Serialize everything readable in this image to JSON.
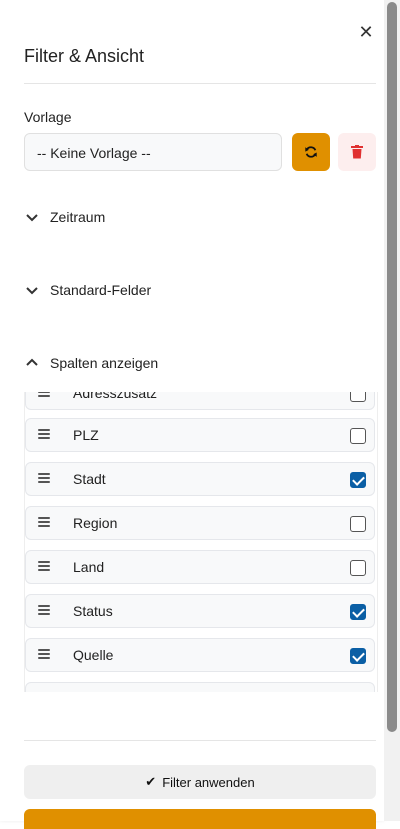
{
  "header": {
    "title": "Filter & Ansicht",
    "close_icon": "close-icon"
  },
  "template": {
    "label": "Vorlage",
    "selected": "-- Keine Vorlage --"
  },
  "accordions": [
    {
      "label": "Zeitraum",
      "expanded": false
    },
    {
      "label": "Standard-Felder",
      "expanded": false
    },
    {
      "label": "Spalten anzeigen",
      "expanded": true
    }
  ],
  "columns": [
    {
      "label": "Adresszusatz",
      "checked": false
    },
    {
      "label": "PLZ",
      "checked": false
    },
    {
      "label": "Stadt",
      "checked": true
    },
    {
      "label": "Region",
      "checked": false
    },
    {
      "label": "Land",
      "checked": false
    },
    {
      "label": "Status",
      "checked": true
    },
    {
      "label": "Quelle",
      "checked": true
    }
  ],
  "footer": {
    "apply_label": "Filter anwenden",
    "apply_icon": "✔"
  },
  "colors": {
    "accent": "#e09000",
    "checkbox": "#0b5fa5",
    "danger": "#e03131"
  }
}
